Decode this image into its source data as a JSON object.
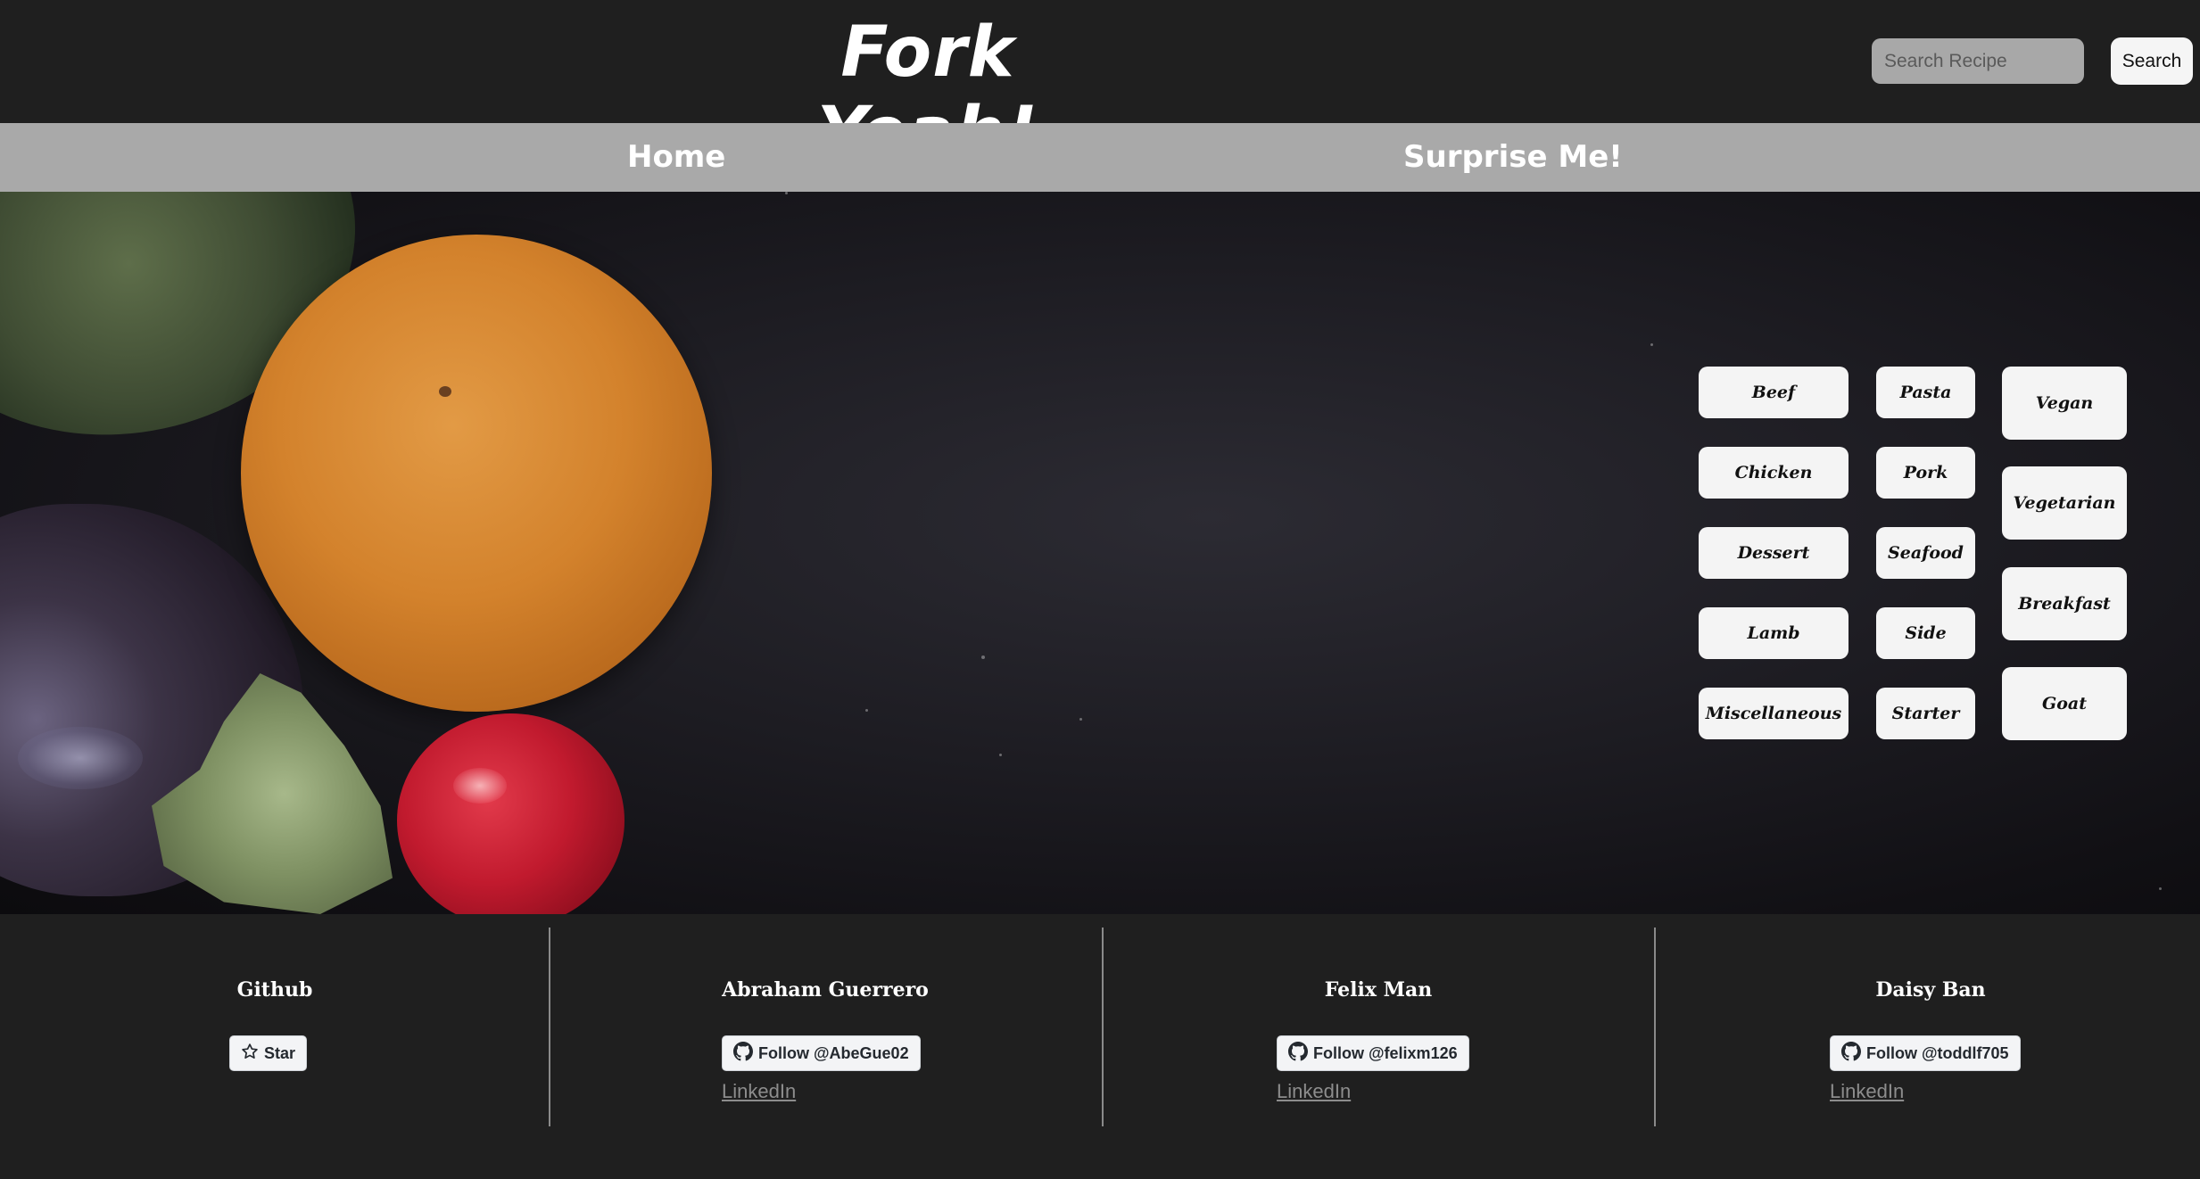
{
  "header": {
    "brand": "Fork Yeah!",
    "search_placeholder": "Search Recipe",
    "search_button": "Search"
  },
  "nav": {
    "home": "Home",
    "surprise": "Surprise Me!"
  },
  "categories": {
    "column1": [
      "Beef",
      "Chicken",
      "Dessert",
      "Lamb",
      "Miscellaneous"
    ],
    "column2": [
      "Pasta",
      "Pork",
      "Seafood",
      "Side",
      "Starter"
    ],
    "column3": [
      "Vegan",
      "Vegetarian",
      "Breakfast",
      "Goat"
    ]
  },
  "footer": {
    "github": {
      "heading": "Github",
      "star_label": "Star"
    },
    "members": [
      {
        "name": "Abraham Guerrero",
        "follow": "Follow @AbeGue02",
        "linkedin": "LinkedIn"
      },
      {
        "name": "Felix Man",
        "follow": "Follow @felixm126",
        "linkedin": "LinkedIn"
      },
      {
        "name": "Daisy Ban",
        "follow": "Follow @toddlf705",
        "linkedin": "LinkedIn"
      }
    ]
  },
  "icons": [
    "star-icon",
    "github-icon"
  ]
}
